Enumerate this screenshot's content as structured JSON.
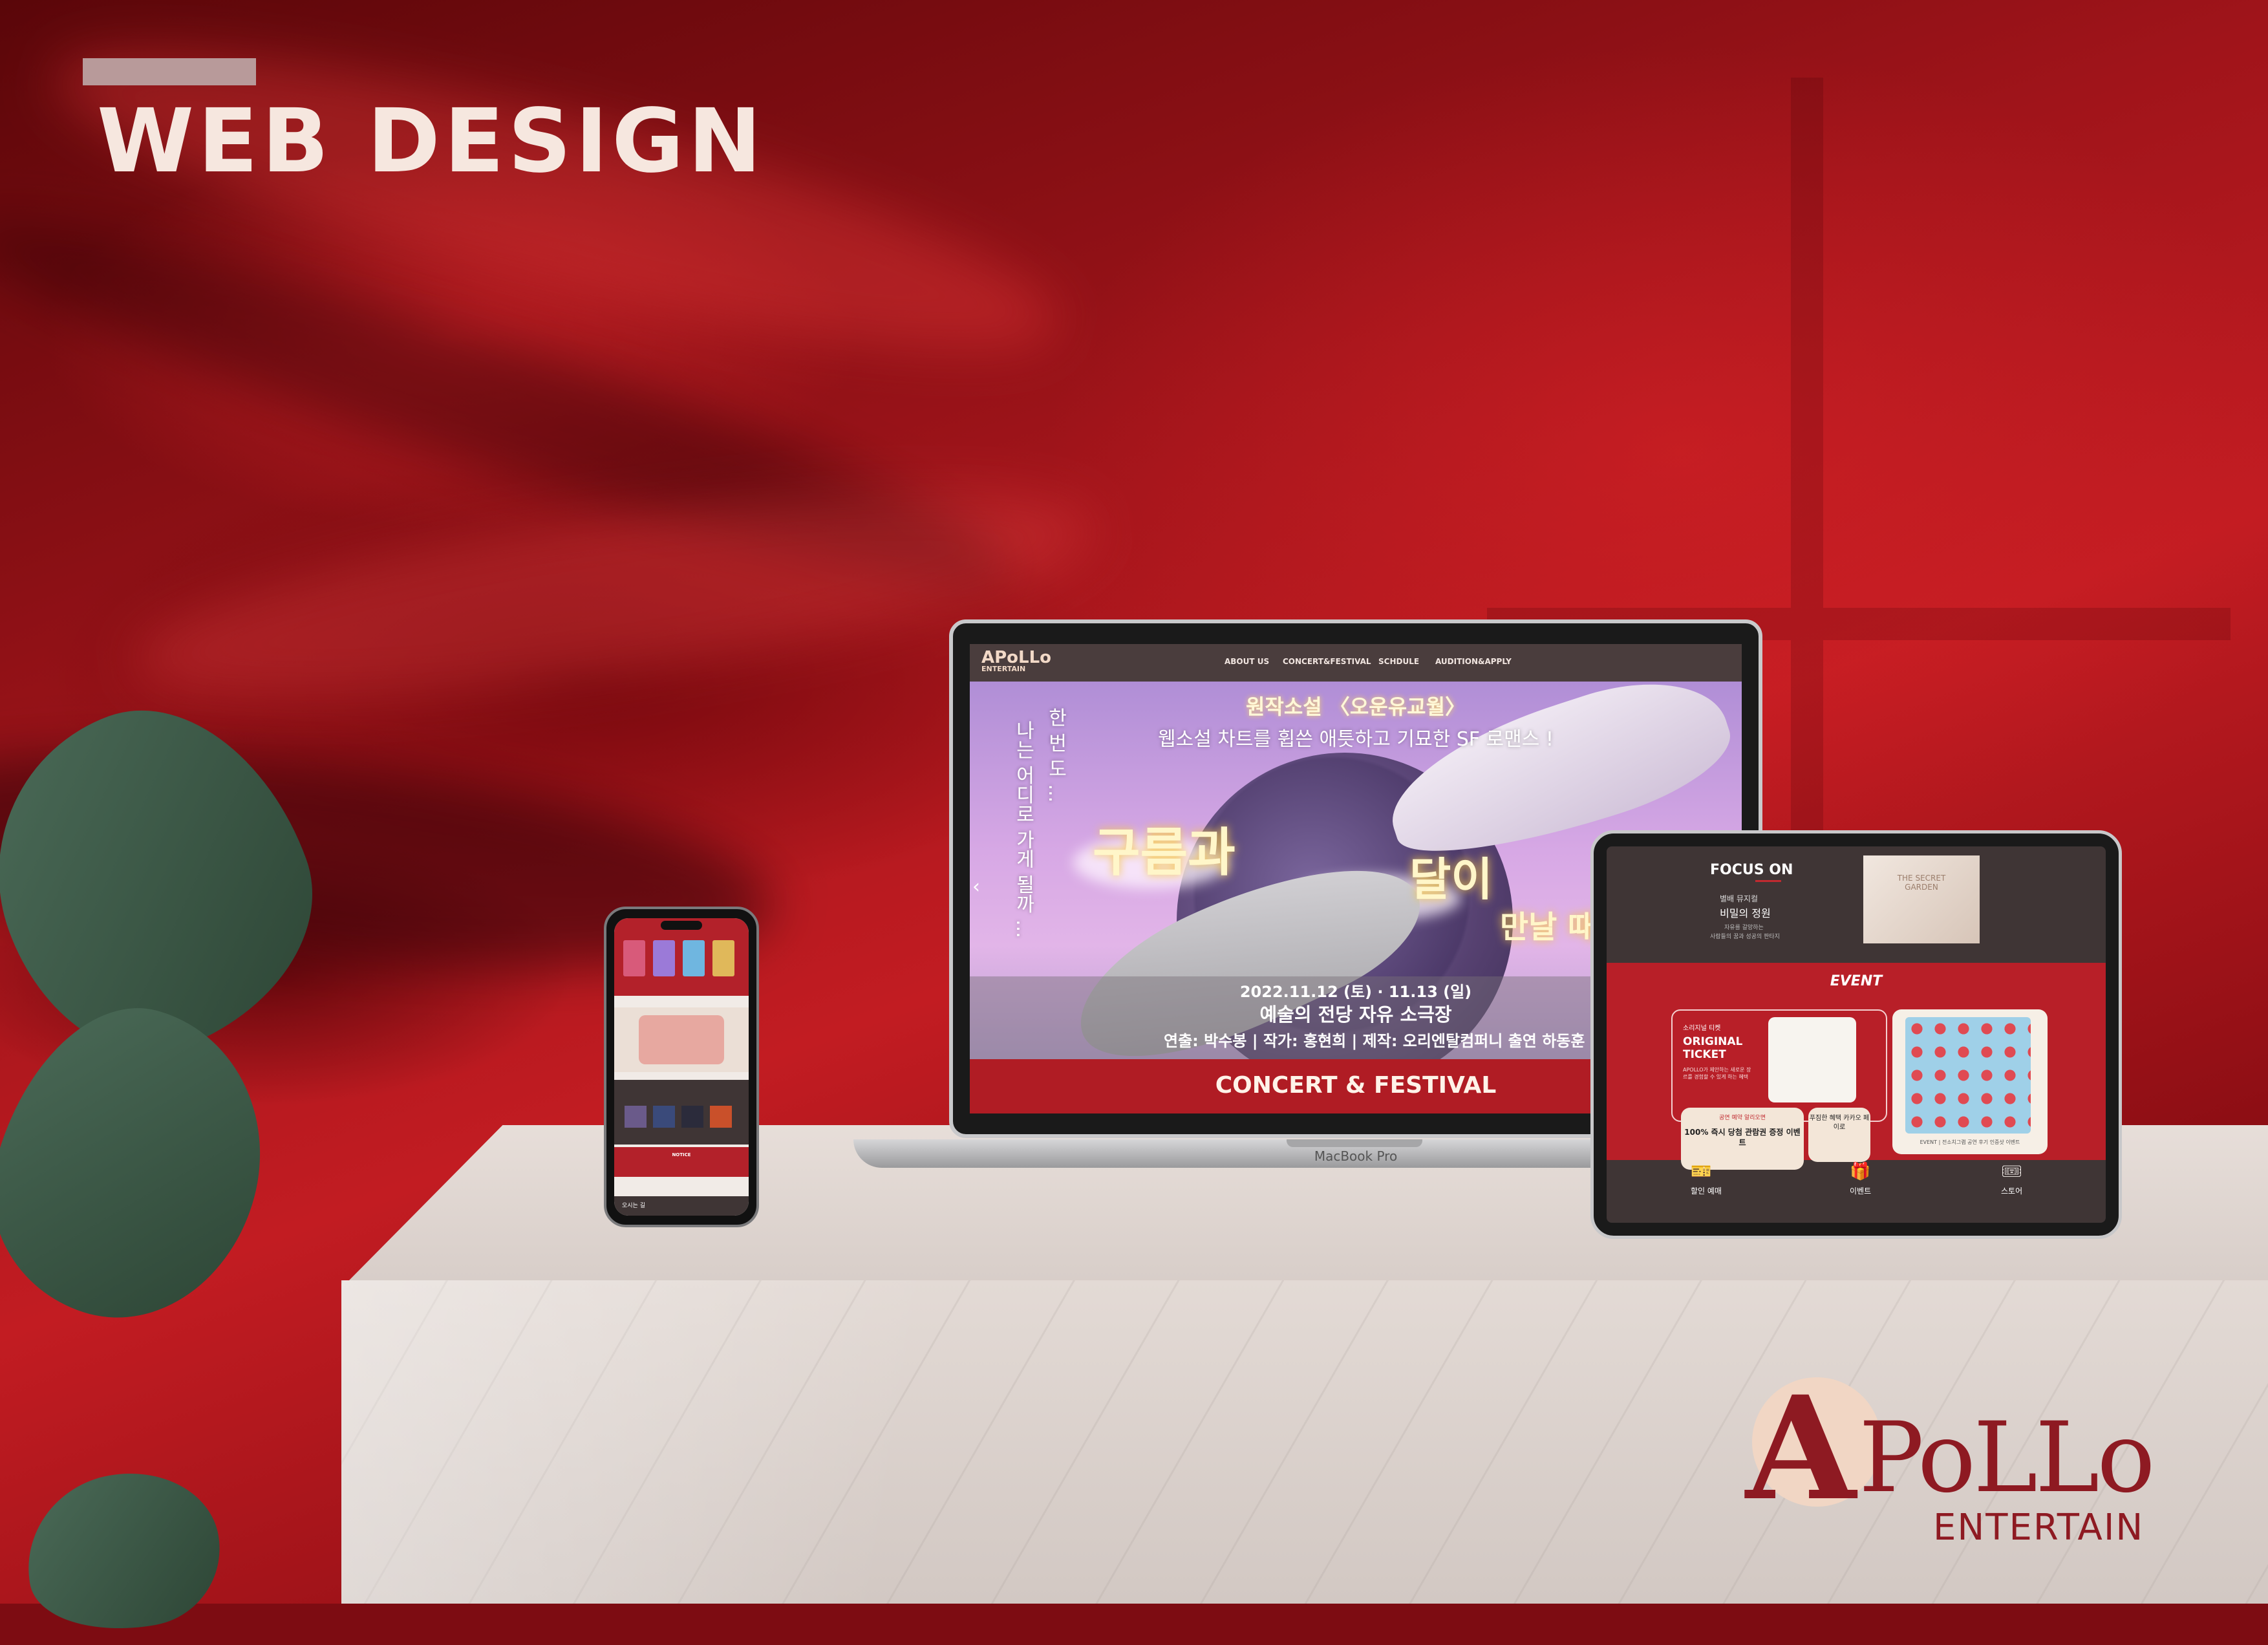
{
  "page": {
    "title": "WEB DESIGN",
    "background": "red drapery with marble pedestal",
    "accent_color": "#b01c24"
  },
  "laptop": {
    "device_label": "MacBook Pro",
    "logo_text": "APoLLo",
    "logo_sub": "ENTERTAIN",
    "nav": [
      "ABOUT US",
      "CONCERT&FESTIVAL",
      "SCHDULE",
      "AUDITION&APPLY"
    ],
    "hero": {
      "subtitle1": "원작소설 〈오운유교월〉",
      "subtitle2": "웹소설 차트를 휩쓴 애틋하고 기묘한 SF 로맨스 !",
      "vertical_left": "나는 어디로 가게 될까 ...",
      "vertical_right": "한 번 도 ...",
      "title_part1": "구름과",
      "title_part2": "달이",
      "title_part3": "만날 때",
      "date": "2022.11.12 (토) · 11.13 (일)",
      "venue": "예술의 전당 자유 소극장",
      "credits": "연출: 박수봉 | 작가: 홍현희 | 제작: 오리엔탈컴퍼니    출연 하동훈"
    },
    "band_title": "CONCERT & FESTIVAL"
  },
  "tablet": {
    "focus_title": "FOCUS ON",
    "focus_sub1": "별배 뮤지컬",
    "focus_sub2": "비밀의 정원",
    "focus_desc1": "자유를 갈망하는",
    "focus_desc2": "사람들의 꿈과 성공의 판타지",
    "card_text": "THE SECRET GARDEN",
    "event_title": "EVENT",
    "ticket_label": "소리지널 티켓",
    "ticket_big": "ORIGINAL TICKET",
    "ticket_desc": "APOLLO가 제안하는 새로운 장르를 경험할 수 있게 하는 혜택",
    "pill1_top": "공연 예약 알리오면",
    "pill1_main": "100% 즉시 당첨 관람권 증정 이벤트",
    "pill2_main": "푸짐한 혜택 카카오 페이로",
    "right_caption": "EVENT | 전소치그램 공연 후기 인증샷 이벤트",
    "footer": [
      {
        "icon": "ticket-icon",
        "label": "할인 예매"
      },
      {
        "icon": "gift-icon",
        "label": "이벤트"
      },
      {
        "icon": "store-icon",
        "label": "스토어"
      }
    ]
  },
  "phone": {
    "notice_title": "NOTICE",
    "bottom_label": "오시는 길"
  },
  "brand": {
    "letter": "A",
    "rest": "PoLLo",
    "sub": "ENTERTAIN"
  }
}
